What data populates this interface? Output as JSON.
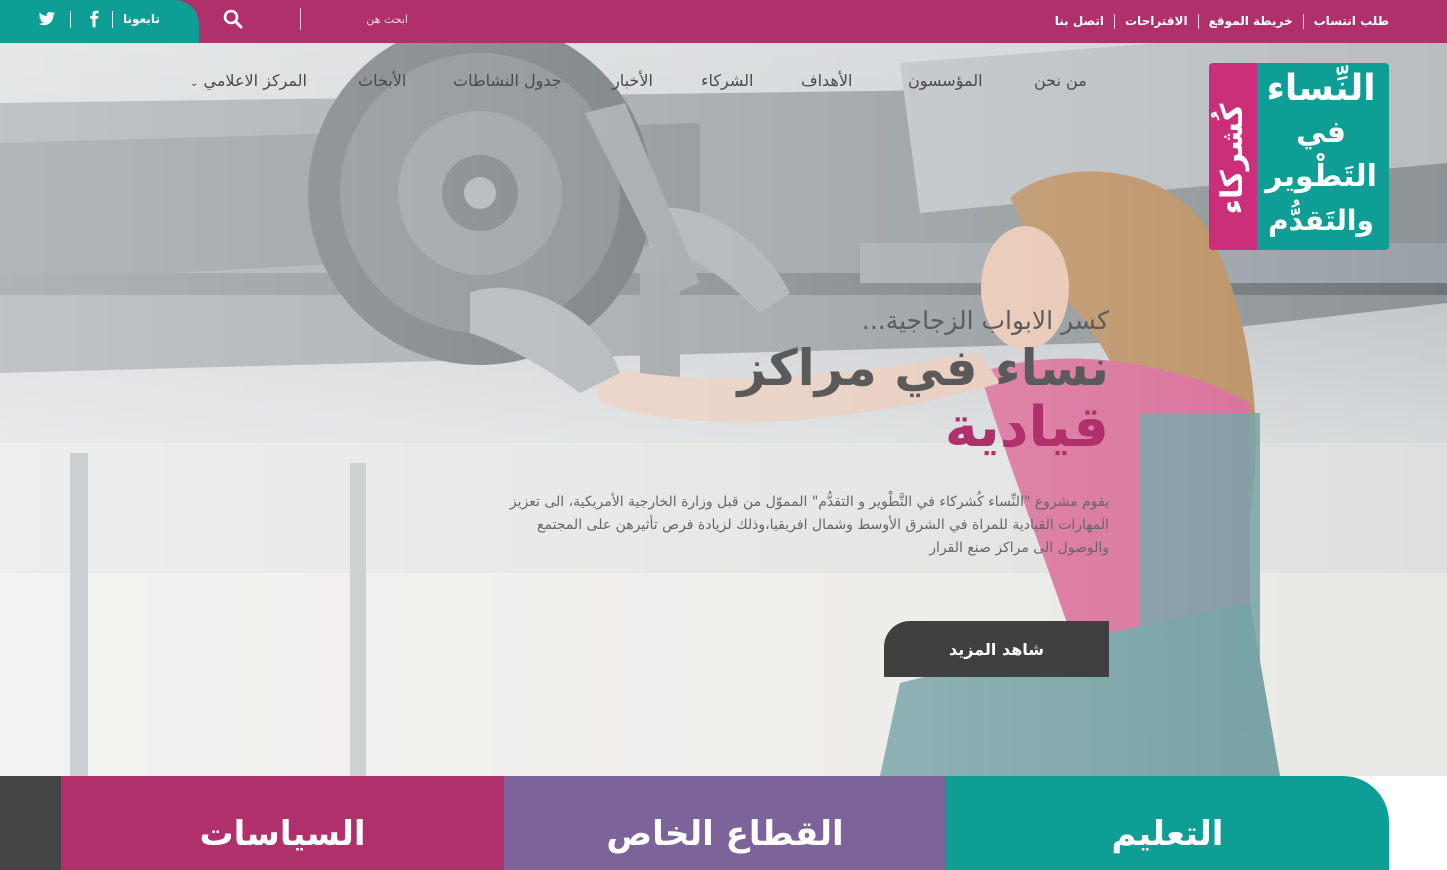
{
  "topbar": {
    "follow_label": "تابعونا",
    "search_placeholder": "ابحث هن",
    "social_icons": [
      "twitter-icon",
      "facebook-icon"
    ],
    "links": [
      "طلب انتساب",
      "خريطة الموقع",
      "الاقتراحات",
      "اتصل بنا"
    ]
  },
  "logo": {
    "side": "كُشركاء",
    "line1": "النِّساء",
    "line2": "في",
    "line3": "التَطْوير",
    "line4": "والتَقدُّم"
  },
  "nav": {
    "items": [
      "من نحن",
      "المؤسسون",
      "الأهداف",
      "الشركاء",
      "الأخبار",
      "جدول النشاطات",
      "الأبحاث",
      "المركز الاعلامي"
    ]
  },
  "hero": {
    "kicker": "كسر الابواب الزجاجية...",
    "headline": "نساء في مراكز",
    "headline_accent": "قيادية",
    "description": "يقوم مشروع \"النِّساء كُشركاء في التَّطْوير و التقدُّم\" المموّل من قبل وزارة الخارجية الأمريكية، الى تعزيز المهارات القيادية للمراة في الشرق الأوسط وشمال افريقيا،وذلك لزيادة فرص تأثيرهن على المجتمع والوصول الى مراكز صنع القرار",
    "cta": "شاهد المزيد"
  },
  "tiles": [
    "التعليم",
    "القطاع الخاص",
    "السياسات"
  ],
  "colors": {
    "magenta": "#b0306b",
    "teal": "#0f9e95",
    "purple": "#7c6399",
    "dark": "#404040"
  }
}
